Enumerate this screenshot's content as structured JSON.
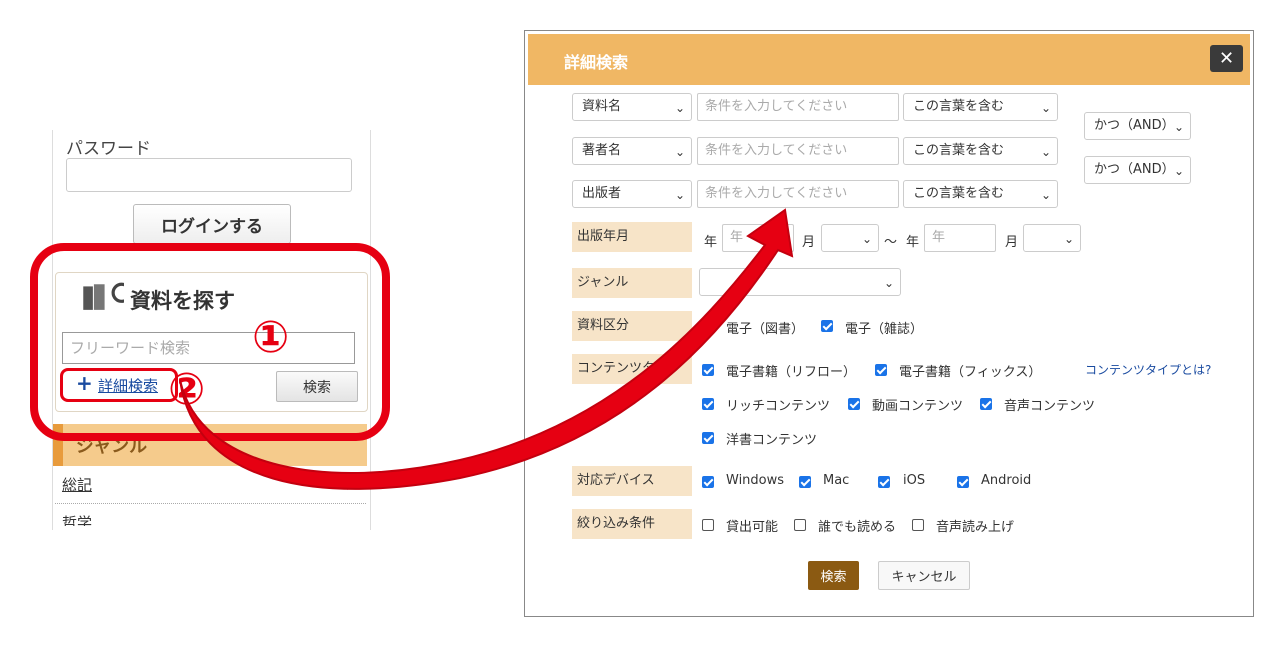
{
  "left": {
    "password_label": "パスワード",
    "login_button": "ログインする",
    "search_title": "資料を探す",
    "free_placeholder": "フリーワード検索",
    "detail_link": "詳細検索",
    "search_button": "検索",
    "genre_header": "ジャンル",
    "categories": [
      {
        "label": "総記"
      },
      {
        "label": "哲学"
      }
    ],
    "annotation_1": "①",
    "annotation_2": "②"
  },
  "dialog": {
    "title": "詳細検索",
    "close_label": "✕",
    "condition_rows": [
      {
        "field": "資料名",
        "placeholder": "条件を入力してください",
        "match": "この言葉を含む"
      },
      {
        "field": "著者名",
        "placeholder": "条件を入力してください",
        "match": "この言葉を含む"
      },
      {
        "field": "出版者",
        "placeholder": "条件を入力してください",
        "match": "この言葉を含む"
      }
    ],
    "operators": [
      "かつ（AND）",
      "かつ（AND）"
    ],
    "pubdate": {
      "label": "出版年月",
      "year_prefix": "年",
      "year_placeholder": "年",
      "month_label": "月",
      "tilde": "～"
    },
    "genre_label": "ジャンル",
    "material_label": "資料区分",
    "material_options": [
      {
        "label": "電子（図書）",
        "checked": true
      },
      {
        "label": "電子（雑誌）",
        "checked": true
      }
    ],
    "content_label": "コンテンツタイプ",
    "content_help": "コンテンツタイプとは?",
    "content_options": [
      {
        "label": "電子書籍（リフロー）",
        "checked": true
      },
      {
        "label": "電子書籍（フィックス）",
        "checked": true
      },
      {
        "label": "リッチコンテンツ",
        "checked": true
      },
      {
        "label": "動画コンテンツ",
        "checked": true
      },
      {
        "label": "音声コンテンツ",
        "checked": true
      },
      {
        "label": "洋書コンテンツ",
        "checked": true
      }
    ],
    "device_label": "対応デバイス",
    "device_options": [
      {
        "label": "Windows",
        "checked": true
      },
      {
        "label": "Mac",
        "checked": true
      },
      {
        "label": "iOS",
        "checked": true
      },
      {
        "label": "Android",
        "checked": true
      }
    ],
    "filter_label": "絞り込み条件",
    "filter_options": [
      {
        "label": "貸出可能",
        "checked": false
      },
      {
        "label": "誰でも読める",
        "checked": false
      },
      {
        "label": "音声読み上げ",
        "checked": false
      }
    ],
    "search_button": "検索",
    "cancel_button": "キャンセル"
  },
  "colors": {
    "header": "#f0b764",
    "label_bg": "#f7e4c8",
    "search_btn": "#8b5a12",
    "annotation_red": "#e60012",
    "checkbox": "#1a73e8"
  }
}
